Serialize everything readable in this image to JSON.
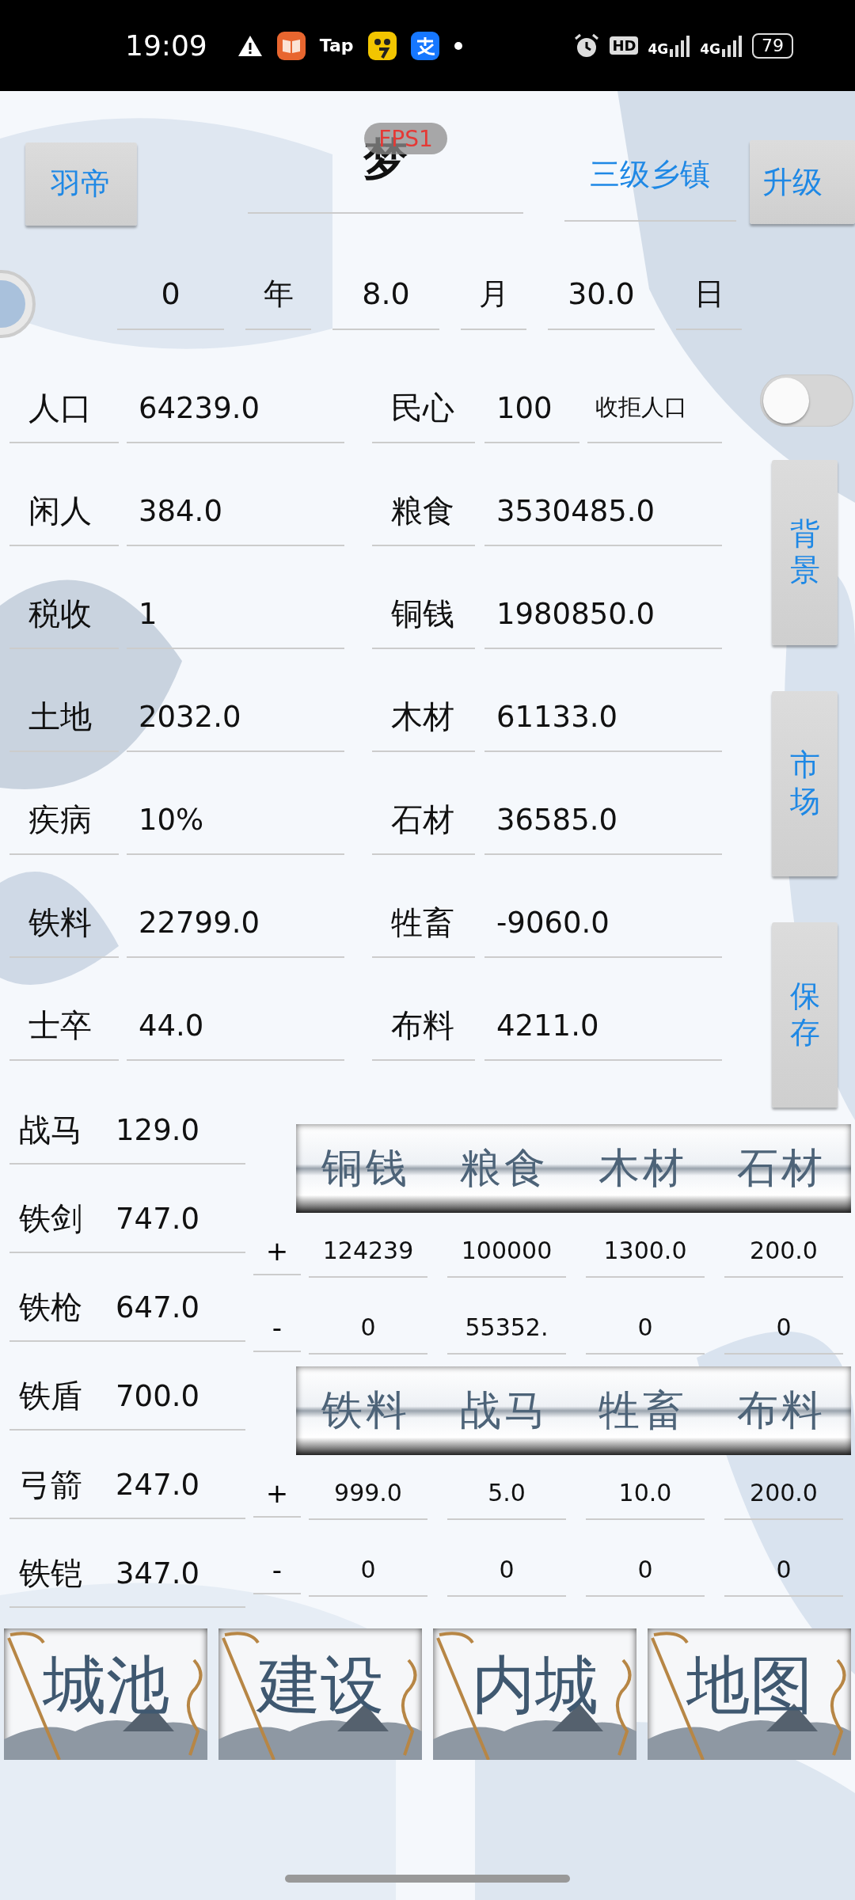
{
  "status_bar": {
    "time": "19:09",
    "app_label": "Tap",
    "hd_label": "HD",
    "network_labels": [
      "4G",
      "4G"
    ],
    "battery": "79"
  },
  "header": {
    "left_button": "羽帝",
    "title": "梦",
    "fps_badge": "FPS1",
    "rank": "三级乡镇",
    "upgrade_button": "升级"
  },
  "date": [
    {
      "kind": "field",
      "text": "0"
    },
    {
      "kind": "unit",
      "text": "年"
    },
    {
      "kind": "field",
      "text": "8.0"
    },
    {
      "kind": "unit",
      "text": "月"
    },
    {
      "kind": "field",
      "text": "30.0"
    },
    {
      "kind": "unit",
      "text": "日"
    }
  ],
  "stats": [
    {
      "label": "人口",
      "value": "64239.0",
      "label_2": "民心",
      "value_2": "100",
      "extra_label": "收拒人口",
      "switch_on": false
    },
    {
      "label": "闲人",
      "value": "384.0",
      "label_2": "粮食",
      "value_2": "3530485.0"
    },
    {
      "label": "税收",
      "value": "1",
      "label_2": "铜钱",
      "value_2": "1980850.0"
    },
    {
      "label": "土地",
      "value": "2032.0",
      "label_2": "木材",
      "value_2": "61133.0"
    },
    {
      "label": "疾病",
      "value": "10%",
      "label_2": "石材",
      "value_2": "36585.0"
    },
    {
      "label": "铁料",
      "value": "22799.0",
      "label_2": "牲畜",
      "value_2": "-9060.0"
    },
    {
      "label": "士卒",
      "value": "44.0",
      "label_2": "布料",
      "value_2": "4211.0"
    }
  ],
  "side_buttons": [
    "背景",
    "市场",
    "保存"
  ],
  "units": [
    {
      "label": "战马",
      "value": "129.0"
    },
    {
      "label": "铁剑",
      "value": "747.0"
    },
    {
      "label": "铁枪",
      "value": "647.0"
    },
    {
      "label": "铁盾",
      "value": "700.0"
    },
    {
      "label": "弓箭",
      "value": "247.0"
    },
    {
      "label": "铁铠",
      "value": "347.0"
    }
  ],
  "trade": [
    {
      "headers": [
        "铜钱",
        "粮食",
        "木材",
        "石材"
      ],
      "plus_sign": "+",
      "plus": [
        "124239",
        "100000",
        "1300.0",
        "200.0"
      ],
      "minus_sign": "-",
      "minus": [
        "0",
        "55352.",
        "0",
        "0"
      ]
    },
    {
      "headers": [
        "铁料",
        "战马",
        "牲畜",
        "布料"
      ],
      "plus_sign": "+",
      "plus": [
        "999.0",
        "5.0",
        "10.0",
        "200.0"
      ],
      "minus_sign": "-",
      "minus": [
        "0",
        "0",
        "0",
        "0"
      ]
    }
  ],
  "nav_tiles": [
    "城池",
    "建设",
    "内城",
    "地图"
  ]
}
